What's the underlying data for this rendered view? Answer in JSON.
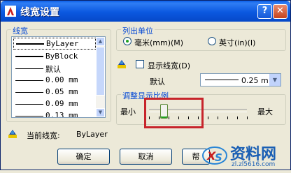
{
  "window": {
    "title": "线宽设置",
    "help": "?",
    "close": "✕"
  },
  "lineweights": {
    "legend": "线宽",
    "items": [
      {
        "label": "ByLayer",
        "thick": true,
        "selected": true
      },
      {
        "label": "ByBlock",
        "thick": true,
        "selected": false
      },
      {
        "label": "默认",
        "thick": false,
        "selected": false
      },
      {
        "label": "0.00 mm",
        "thick": false,
        "selected": false
      },
      {
        "label": "0.05 mm",
        "thick": false,
        "selected": false
      },
      {
        "label": "0.09 mm",
        "thick": false,
        "selected": false
      },
      {
        "label": "0.13 mm",
        "thick": false,
        "selected": false
      }
    ]
  },
  "units": {
    "legend": "列出单位",
    "mm_label": "毫米(mm)(M)",
    "inch_label": "英寸(in)(I)",
    "selected": "mm"
  },
  "display": {
    "checkbox_label": "显示线宽(D)",
    "checked": false,
    "default_label": "默认",
    "default_value": "0.25 mm"
  },
  "scale": {
    "legend": "调整显示比例",
    "min_label": "最小",
    "max_label": "最大",
    "level_fraction": 0.15
  },
  "current": {
    "label": "当前线宽:",
    "value": "ByLayer"
  },
  "buttons": {
    "ok": "确定",
    "cancel": "取消",
    "help": "帮"
  },
  "watermark": {
    "text": "资料网",
    "url": "zl.zl5616.com",
    "logo": "XS"
  },
  "colors": {
    "title_blue": "#0a5ee8",
    "highlight_red": "#c7242b",
    "legend_blue": "#0046d5"
  }
}
